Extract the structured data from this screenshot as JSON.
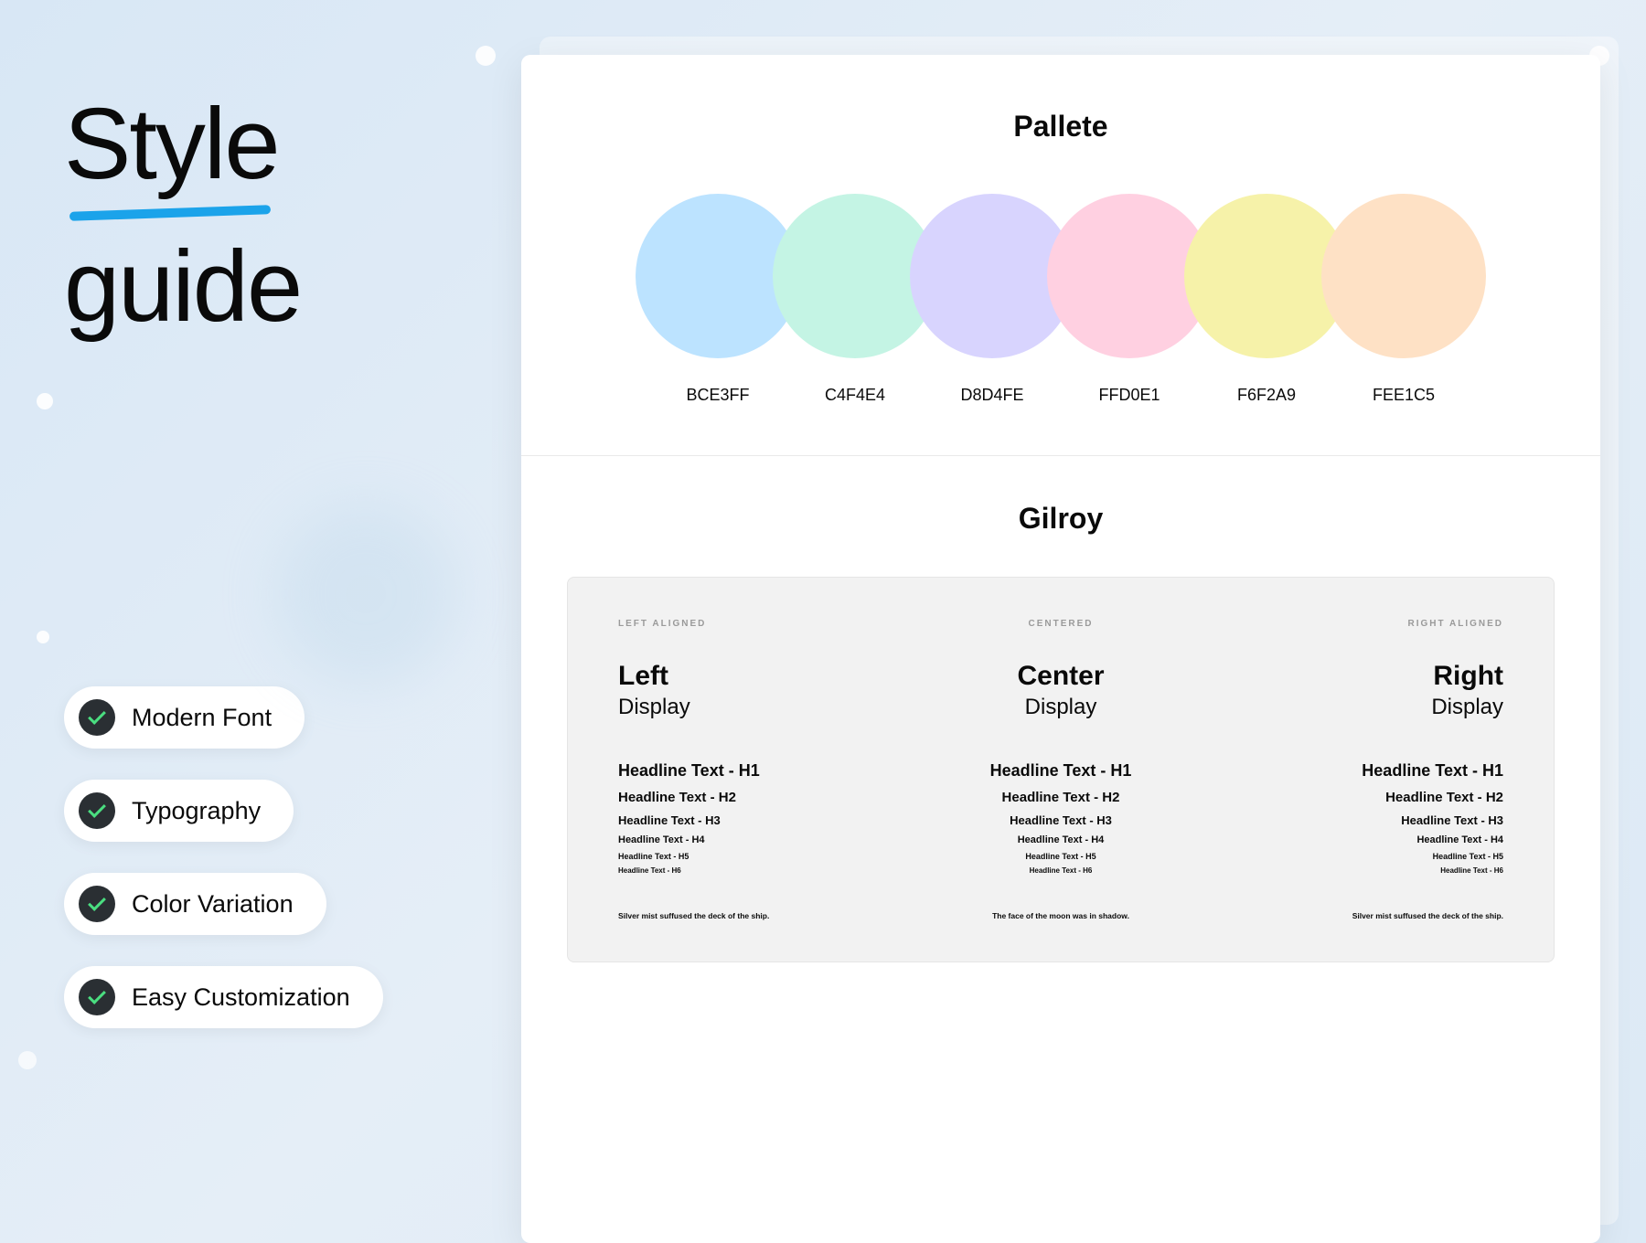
{
  "title": {
    "word1": "Style",
    "word2": "guide"
  },
  "features": [
    {
      "label": "Modern Font"
    },
    {
      "label": "Typography"
    },
    {
      "label": "Color Variation"
    },
    {
      "label": "Easy Customization"
    }
  ],
  "palette": {
    "title": "Pallete",
    "swatches": [
      {
        "hex": "BCE3FF",
        "color": "#BCE3FF"
      },
      {
        "hex": "C4F4E4",
        "color": "#C4F4E4"
      },
      {
        "hex": "D8D4FE",
        "color": "#D8D4FE"
      },
      {
        "hex": "FFD0E1",
        "color": "#FFD0E1"
      },
      {
        "hex": "F6F2A9",
        "color": "#F6F2A9"
      },
      {
        "hex": "FEE1C5",
        "color": "#FEE1C5"
      }
    ]
  },
  "typography": {
    "title": "Gilroy",
    "columns": [
      {
        "eyebrow": "LEFT ALIGNED",
        "displayH": "Left",
        "displayS": "Display"
      },
      {
        "eyebrow": "CENTERED",
        "displayH": "Center",
        "displayS": "Display"
      },
      {
        "eyebrow": "RIGHT ALIGNED",
        "displayH": "Right",
        "displayS": "Display"
      }
    ],
    "headlines": {
      "h1": "Headline Text - H1",
      "h2": "Headline Text - H2",
      "h3": "Headline Text - H3",
      "h4": "Headline Text - H4",
      "h5": "Headline Text - H5",
      "h6": "Headline Text - H6"
    },
    "body": [
      "Silver mist suffused the deck of the ship.",
      "The face of the moon was in shadow.",
      "Silver mist suffused the deck of the ship."
    ]
  }
}
